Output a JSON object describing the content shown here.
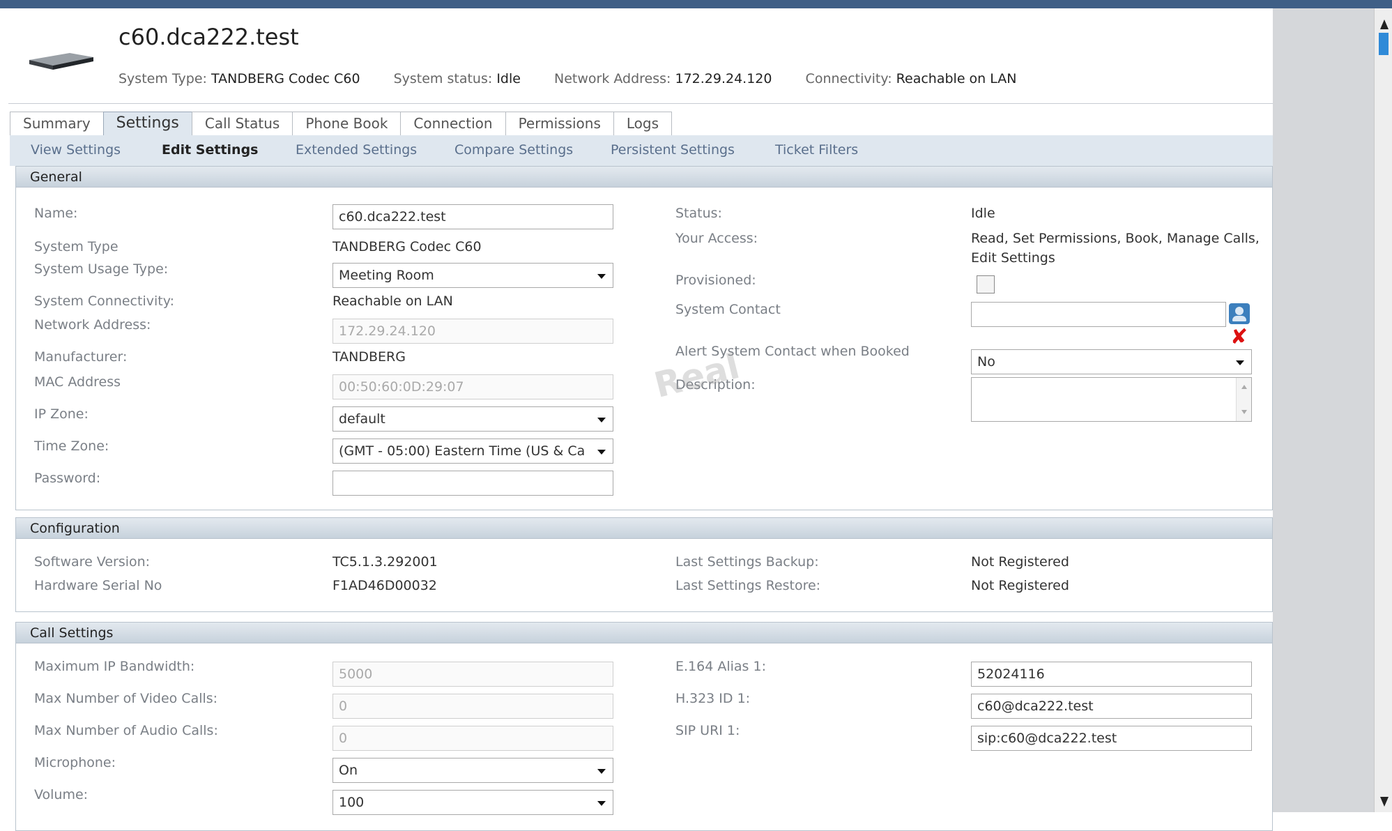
{
  "header": {
    "system_name": "c60.dca222.test",
    "meta": [
      {
        "label": "System Type:",
        "value": "TANDBERG Codec C60"
      },
      {
        "label": "System status:",
        "value": "Idle"
      },
      {
        "label": "Network Address:",
        "value": "172.29.24.120"
      },
      {
        "label": "Connectivity:",
        "value": "Reachable on LAN"
      }
    ]
  },
  "tabs": [
    "Summary",
    "Settings",
    "Call Status",
    "Phone Book",
    "Connection",
    "Permissions",
    "Logs"
  ],
  "active_tab": "Settings",
  "subnav": [
    "View Settings",
    "Edit Settings",
    "Extended Settings",
    "Compare Settings",
    "Persistent Settings",
    "Ticket Filters"
  ],
  "active_subnav": "Edit Settings",
  "watermark": "Real",
  "general": {
    "title": "General",
    "name_label": "Name:",
    "name_value": "c60.dca222.test",
    "system_type_label": "System Type",
    "system_type_value": "TANDBERG Codec C60",
    "usage_type_label": "System Usage Type:",
    "usage_type_value": "Meeting Room",
    "connectivity_label": "System Connectivity:",
    "connectivity_value": "Reachable on LAN",
    "network_address_label": "Network Address:",
    "network_address_value": "172.29.24.120",
    "manufacturer_label": "Manufacturer:",
    "manufacturer_value": "TANDBERG",
    "mac_label": "MAC Address",
    "mac_value": "00:50:60:0D:29:07",
    "ip_zone_label": "IP Zone:",
    "ip_zone_value": "default",
    "time_zone_label": "Time Zone:",
    "time_zone_value": "(GMT - 05:00) Eastern Time (US & Ca",
    "password_label": "Password:",
    "password_value": "",
    "status_label": "Status:",
    "status_value": "Idle",
    "access_label": "Your Access:",
    "access_value_line1": "Read, Set Permissions, Book, Manage Calls,",
    "access_value_line2": "Edit Settings",
    "provisioned_label": "Provisioned:",
    "system_contact_label": "System Contact",
    "system_contact_value": "",
    "alert_label": "Alert System Contact when Booked",
    "alert_value": "No",
    "description_label": "Description:"
  },
  "configuration": {
    "title": "Configuration",
    "software_label": "Software Version:",
    "software_value": "TC5.1.3.292001",
    "serial_label": "Hardware Serial No",
    "serial_value": "F1AD46D00032",
    "backup_label": "Last Settings Backup:",
    "backup_value": "Not Registered",
    "restore_label": "Last Settings Restore:",
    "restore_value": "Not Registered"
  },
  "call_settings": {
    "title": "Call Settings",
    "bandwidth_label": "Maximum IP Bandwidth:",
    "bandwidth_value": "5000",
    "video_calls_label": "Max Number of Video Calls:",
    "video_calls_value": "0",
    "audio_calls_label": "Max Number of Audio Calls:",
    "audio_calls_value": "0",
    "microphone_label": "Microphone:",
    "microphone_value": "On",
    "volume_label": "Volume:",
    "volume_value": "100",
    "e164_label": "E.164 Alias 1:",
    "e164_value": "52024116",
    "h323_label": "H.323 ID 1:",
    "h323_value": "c60@dca222.test",
    "sip_label": "SIP URI 1:",
    "sip_value": "sip:c60@dca222.test"
  }
}
